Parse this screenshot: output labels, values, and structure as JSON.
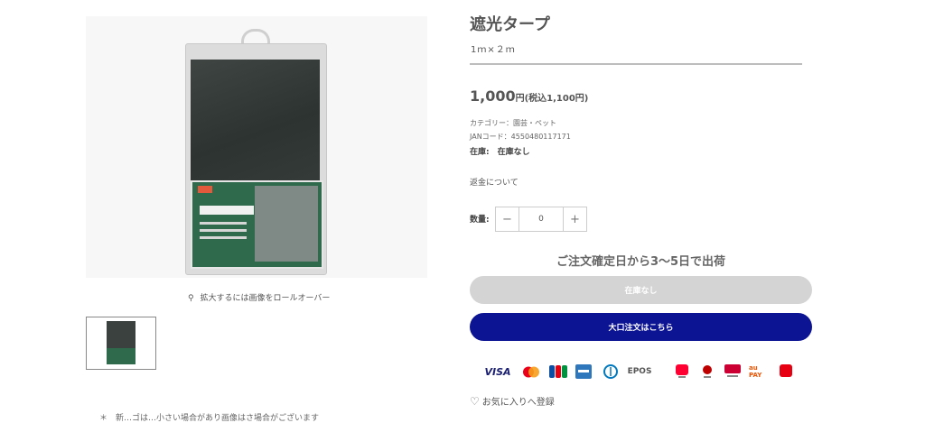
{
  "product": {
    "title": "遮光タープ",
    "size": "1ｍ×２ｍ",
    "price": "1,000",
    "price_unit": "円",
    "price_tax": "(税込1,100円)",
    "category": "カテゴリー：園芸・ペット",
    "jan": "JANコード：4550480117171",
    "stock": "在庫:　在庫なし",
    "refund_link": "返金について"
  },
  "gallery": {
    "zoom_hint": "拡大するには画像をロールオーバー",
    "cut_text": "＊　新…ゴは…小さい場合があり画像はさ場合がございます"
  },
  "quantity": {
    "label": "数量:",
    "value": "0",
    "minus": "−",
    "plus": "+"
  },
  "shipping_note": "ご注文確定日から3〜5日で出荷",
  "buttons": {
    "soldout": "在庫なし",
    "bulk": "大口注文はこちら"
  },
  "payments": [
    {
      "name": "VISA",
      "color": "#1a1f71"
    },
    {
      "name": "Mastercard",
      "color": "#eb001b"
    },
    {
      "name": "JCB",
      "color": "#0b4ea2"
    },
    {
      "name": "AMEX",
      "color": "#2e77bc"
    },
    {
      "name": "Diners Club",
      "color": "#0079be"
    },
    {
      "name": "EPOS",
      "color": "#555555"
    },
    {
      "name": "PayPay",
      "color": "#ff0033"
    },
    {
      "name": "楽天Pay",
      "color": "#bf0000"
    },
    {
      "name": "d払い",
      "color": "#cc0033"
    },
    {
      "name": "au PAY",
      "color": "#eb5505"
    },
    {
      "name": "メルペイ",
      "color": "#e60012"
    }
  ],
  "favorite_label": "お気に入りへ登録",
  "colors": {
    "accent": "#0d1493",
    "disabled": "#d4d4d4"
  }
}
